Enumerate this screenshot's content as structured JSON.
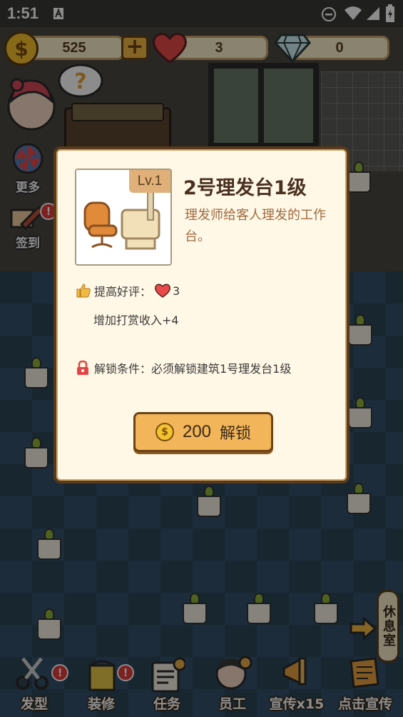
{
  "status_bar": {
    "time": "1:51"
  },
  "resources": {
    "coins": "525",
    "hearts": "3",
    "diamonds": "0"
  },
  "side_buttons": {
    "more": "更多",
    "checkin": "签到"
  },
  "bottom_nav": [
    {
      "label": "发型"
    },
    {
      "label": "装修"
    },
    {
      "label": "任务"
    },
    {
      "label": "员工"
    },
    {
      "label": "宣传x15"
    },
    {
      "label": "点击宣传"
    }
  ],
  "rest_room": "休息室",
  "dialog": {
    "level": "Lv.1",
    "title": "2号理发台1级",
    "description": "理发师给客人理发的工作台。",
    "rating_label": "提高好评：",
    "rating_value": "3",
    "tip_income": "增加打赏收入+4",
    "unlock_condition": "解锁条件：必须解锁建筑1号理发台1级",
    "unlock_price": "200",
    "unlock_label": "解锁"
  },
  "colors": {
    "accent": "#f2b55a",
    "heart": "#e84a4a",
    "dialog_bg": "#fff8e6"
  }
}
